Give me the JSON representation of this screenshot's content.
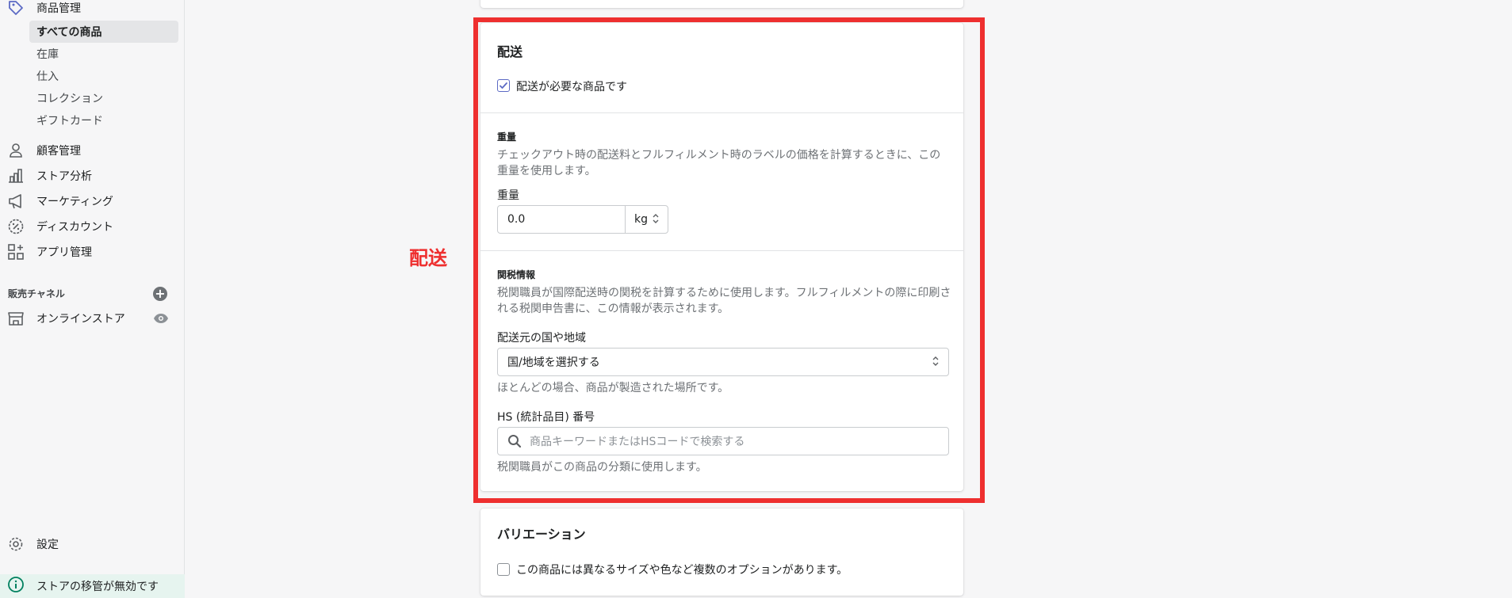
{
  "sidebar": {
    "products": {
      "label": "商品管理",
      "icon": "tag-icon"
    },
    "product_sub": [
      {
        "label": "すべての商品",
        "active": true
      },
      {
        "label": "在庫",
        "active": false
      },
      {
        "label": "仕入",
        "active": false
      },
      {
        "label": "コレクション",
        "active": false
      },
      {
        "label": "ギフトカード",
        "active": false
      }
    ],
    "items": [
      {
        "label": "顧客管理",
        "icon": "person-icon"
      },
      {
        "label": "ストア分析",
        "icon": "bar-chart-icon"
      },
      {
        "label": "マーケティング",
        "icon": "megaphone-icon"
      },
      {
        "label": "ディスカウント",
        "icon": "discount-icon"
      },
      {
        "label": "アプリ管理",
        "icon": "apps-icon"
      }
    ],
    "sales_channels_heading": "販売チャネル",
    "online_store": {
      "label": "オンラインストア",
      "icon": "store-icon"
    },
    "settings": {
      "label": "設定",
      "icon": "gear-icon"
    },
    "notice": {
      "label": "ストアの移管が無効です",
      "icon": "info-icon"
    }
  },
  "shipping": {
    "title": "配送",
    "requires_shipping_label": "配送が必要な商品です",
    "requires_shipping_checked": true,
    "weight": {
      "heading": "重量",
      "help": [
        "チェックアウト時の配送料とフルフィルメント時のラベルの価格を計算するときに、この",
        "重量を使用します。"
      ],
      "field_label": "重量",
      "value": "0.0",
      "unit": "kg"
    },
    "customs": {
      "heading": "関税情報",
      "help": [
        "税関職員が国際配送時の関税を計算するために使用します。フルフィルメントの際に印刷さ",
        "れる税関申告書に、この情報が表示されます。"
      ],
      "origin_label": "配送元の国や地域",
      "origin_value": "国/地域を選択する",
      "origin_help": "ほとんどの場合、商品が製造された場所です。",
      "hs_label": "HS (統計品目) 番号",
      "hs_placeholder": "商品キーワードまたはHSコードで検索する",
      "hs_help": "税関職員がこの商品の分類に使用します。"
    }
  },
  "variants": {
    "title": "バリエーション",
    "options_label": "この商品には異なるサイズや色など複数のオプションがあります。",
    "options_checked": false
  },
  "annotation": {
    "label": "配送",
    "color": "#ee2f2f"
  }
}
